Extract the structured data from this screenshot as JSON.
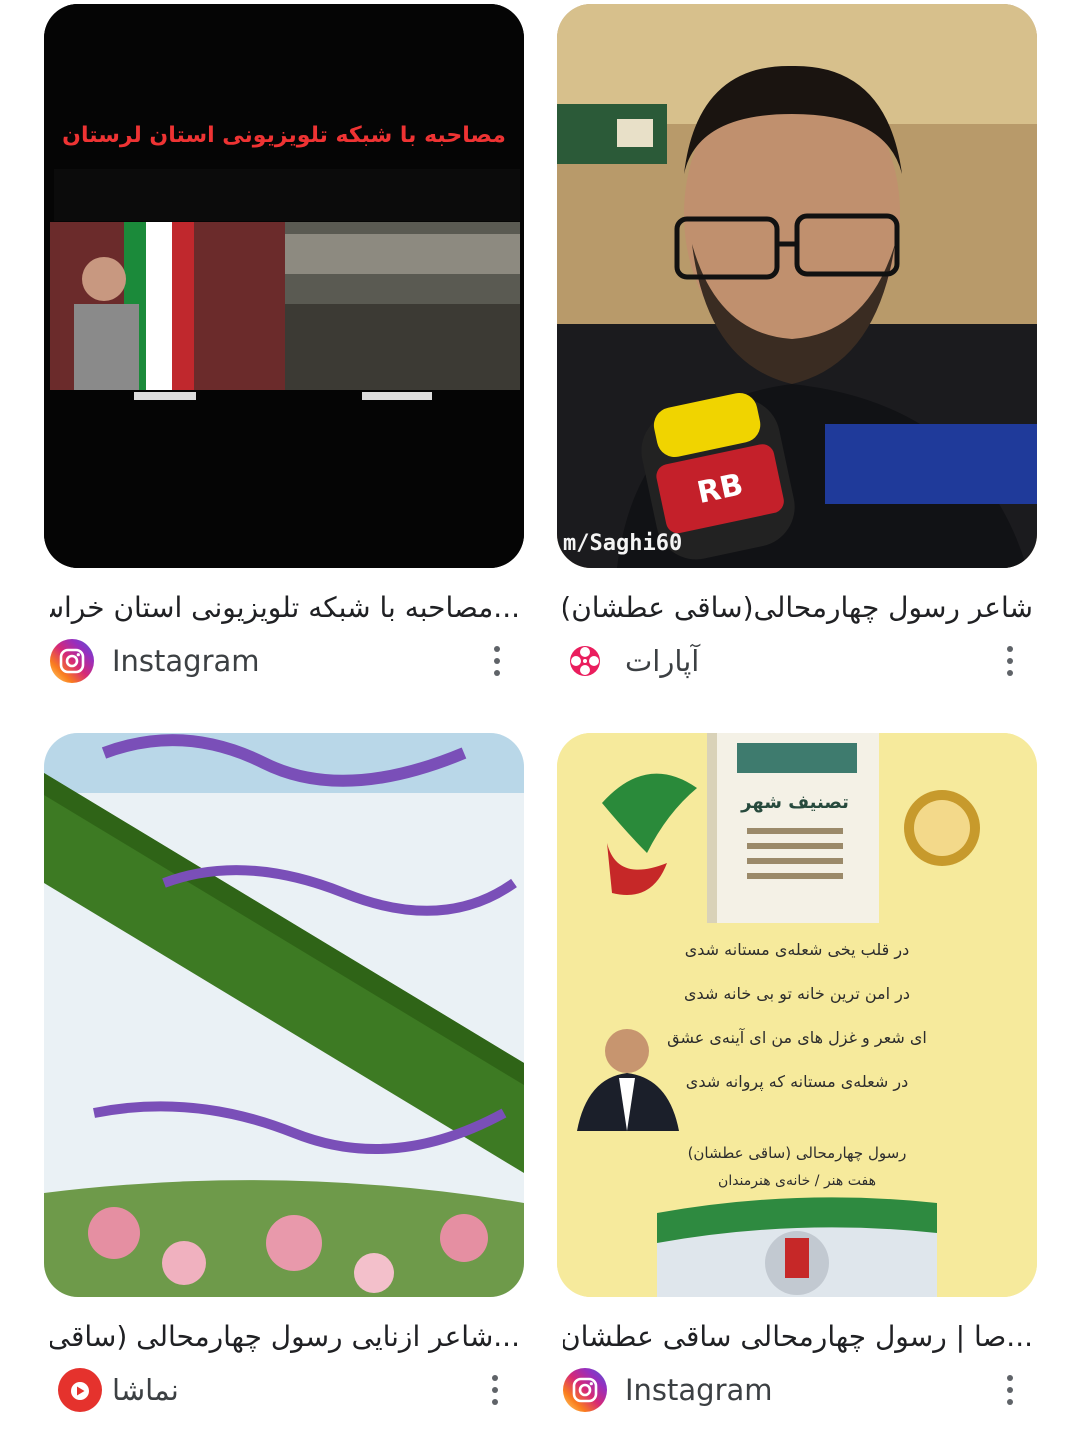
{
  "results": [
    {
      "title": "...مصاحبه با شبکه تلویزیونی استان خراسا",
      "thumb_caption": "مصاحبه با شبکه تلویزیونی استان لرستان",
      "source": "Instagram",
      "source_icon": "instagram-icon"
    },
    {
      "title": "شاعر رسول چهارمحالی(ساقی عطشان)",
      "thumb_caption": "m/Saghi60",
      "source": "آپارات",
      "source_icon": "aparat-icon"
    },
    {
      "title": "...شاعر ازنایی رسول چهارمحالی (ساقی",
      "source": "نماشا",
      "source_icon": "namasha-icon"
    },
    {
      "title": "...صا | رسول چهارمحالی ساقی عطشان",
      "poster_lines": [
        "تصنیف شهر",
        "در قلب یخی شعله‌ی مستانه شدی",
        "در امن ترین خانه تو بی خانه شدی",
        "ای شعر و غزل های من ای آینه‌ی عشق",
        "در شعله‌ی مستانه که پروانه شدی",
        "رسول چهارمحالی (ساقی عطشان)",
        "هفت هنر / خانه‌ی هنرمندان"
      ],
      "source": "Instagram",
      "source_icon": "instagram-icon"
    }
  ],
  "colors": {
    "instagram_gradient_start": "#feda75",
    "instagram_gradient_end": "#d62976",
    "aparat": "#ea1d5d",
    "namasha": "#e5322d"
  }
}
